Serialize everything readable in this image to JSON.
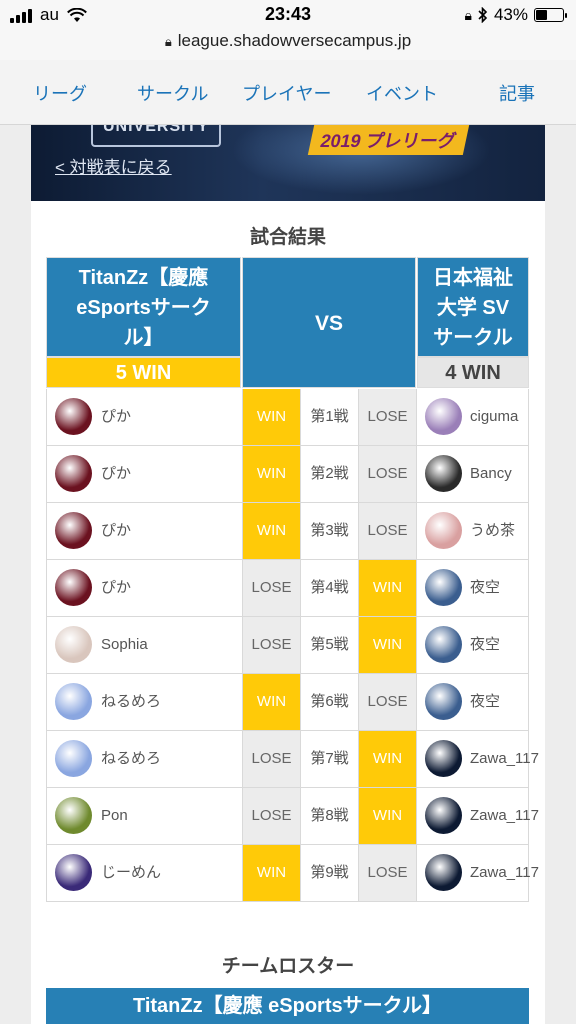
{
  "status": {
    "carrier": "au",
    "time": "23:43",
    "battery": "43%",
    "battery_level": 0.43
  },
  "url": "league.shadowversecampus.jp",
  "nav": [
    "リーグ",
    "サークル",
    "プレイヤー",
    "イベント",
    "記事"
  ],
  "banner": {
    "back_link": "< 対戦表に戻る",
    "season": "2019 プレリーグ",
    "emblem_text": "UNIVERSITY"
  },
  "result_title": "試合結果",
  "teams": {
    "left": {
      "name_lines": [
        "TitanZz【慶應",
        "eSportsサーク",
        "ル】"
      ],
      "score": "5 WIN"
    },
    "vs": "VS",
    "right": {
      "name_lines": [
        "日本福祉",
        "大学 SV",
        "サークル"
      ],
      "score": "4 WIN"
    }
  },
  "matches": [
    {
      "left": "ぴか",
      "left_result": "WIN",
      "game": "第1戦",
      "right_result": "LOSE",
      "right": "ciguma"
    },
    {
      "left": "ぴか",
      "left_result": "WIN",
      "game": "第2戦",
      "right_result": "LOSE",
      "right": "Bancy"
    },
    {
      "left": "ぴか",
      "left_result": "WIN",
      "game": "第3戦",
      "right_result": "LOSE",
      "right": "うめ茶"
    },
    {
      "left": "ぴか",
      "left_result": "LOSE",
      "game": "第4戦",
      "right_result": "WIN",
      "right": "夜空"
    },
    {
      "left": "Sophia",
      "left_result": "LOSE",
      "game": "第5戦",
      "right_result": "WIN",
      "right": "夜空"
    },
    {
      "left": "ねるめろ",
      "left_result": "WIN",
      "game": "第6戦",
      "right_result": "LOSE",
      "right": "夜空"
    },
    {
      "left": "ねるめろ",
      "left_result": "LOSE",
      "game": "第7戦",
      "right_result": "WIN",
      "right": "Zawa_117"
    },
    {
      "left": "Pon",
      "left_result": "LOSE",
      "game": "第8戦",
      "right_result": "WIN",
      "right": "Zawa_117"
    },
    {
      "left": "じーめん",
      "left_result": "WIN",
      "game": "第9戦",
      "right_result": "LOSE",
      "right": "Zawa_117"
    }
  ],
  "roster_title": "チームロスター",
  "roster_team": "TitanZz【慶應 eSportsサークル】",
  "colors": {
    "team_blue": "#2780b5",
    "win_yellow": "#ffca08",
    "lose_gray": "#ececec",
    "link_blue": "#1a73b8"
  }
}
